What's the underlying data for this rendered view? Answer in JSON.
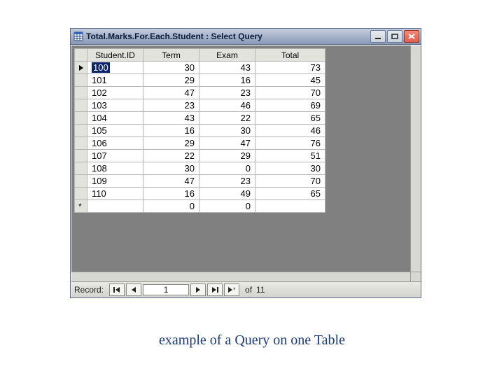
{
  "window": {
    "title": "Total.Marks.For.Each.Student : Select Query"
  },
  "columns": {
    "student_id": "Student.ID",
    "term": "Term",
    "exam": "Exam",
    "total": "Total"
  },
  "rows": [
    {
      "sid": "100",
      "term": "30",
      "exam": "43",
      "total": "73",
      "current": true
    },
    {
      "sid": "101",
      "term": "29",
      "exam": "16",
      "total": "45"
    },
    {
      "sid": "102",
      "term": "47",
      "exam": "23",
      "total": "70"
    },
    {
      "sid": "103",
      "term": "23",
      "exam": "46",
      "total": "69"
    },
    {
      "sid": "104",
      "term": "43",
      "exam": "22",
      "total": "65"
    },
    {
      "sid": "105",
      "term": "16",
      "exam": "30",
      "total": "46"
    },
    {
      "sid": "106",
      "term": "29",
      "exam": "47",
      "total": "76"
    },
    {
      "sid": "107",
      "term": "22",
      "exam": "29",
      "total": "51"
    },
    {
      "sid": "108",
      "term": "30",
      "exam": "0",
      "total": "30"
    },
    {
      "sid": "109",
      "term": "47",
      "exam": "23",
      "total": "70"
    },
    {
      "sid": "110",
      "term": "16",
      "exam": "49",
      "total": "65"
    }
  ],
  "newrow": {
    "term": "0",
    "exam": "0"
  },
  "recordnav": {
    "label": "Record:",
    "current": "1",
    "of_label": "of",
    "total": "11"
  },
  "caption": "example of a Query on one Table"
}
